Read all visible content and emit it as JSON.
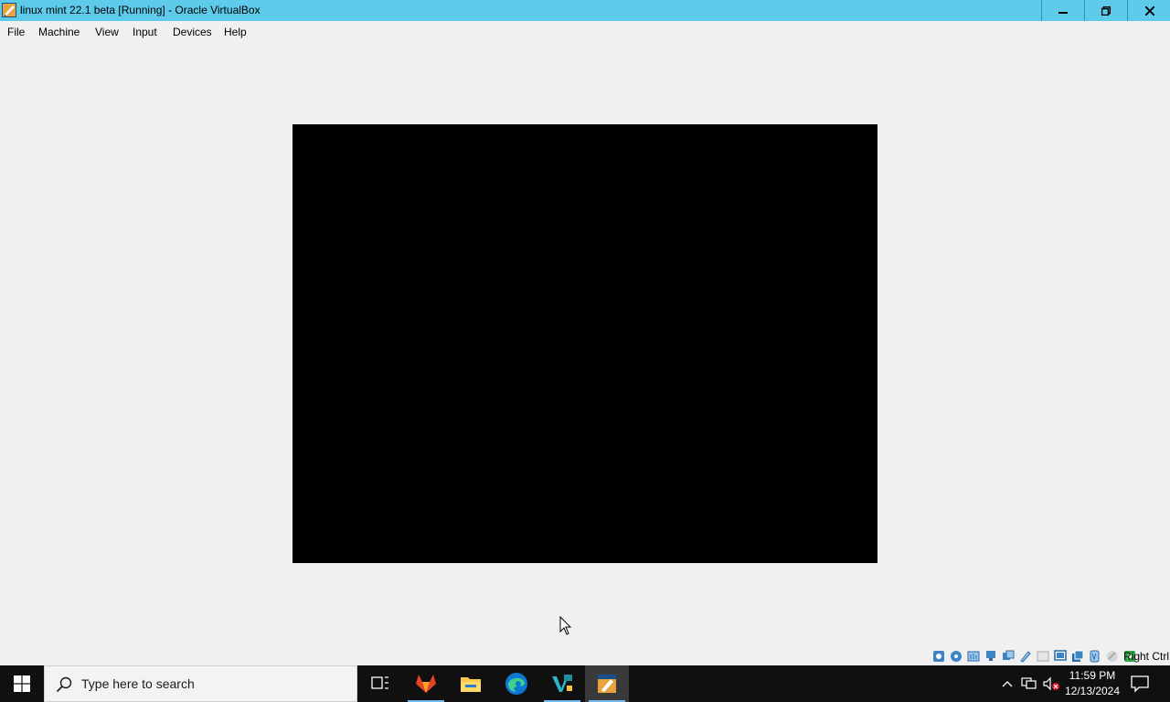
{
  "window": {
    "title": "linux mint 22.1 beta [Running] - Oracle VirtualBox",
    "controls": {
      "minimize": "minimize",
      "restore": "restore",
      "close": "close"
    }
  },
  "menu": {
    "file": "File",
    "machine": "Machine",
    "view": "View",
    "input": "Input",
    "devices": "Devices",
    "help": "Help"
  },
  "statusbar": {
    "icons": [
      "hard-disk-icon",
      "optical-drive-icon",
      "audio-icon",
      "network-icon",
      "usb-icon",
      "shared-folders-icon",
      "display-icon",
      "recording-icon",
      "cpu-icon",
      "mouse-integration-icon",
      "keyboard-icon"
    ],
    "host_key": "Right Ctrl"
  },
  "taskbar": {
    "search_placeholder": "Type here to search",
    "apps": [
      "task-view-icon",
      "gitlab-icon",
      "file-explorer-icon",
      "edge-icon",
      "visual-studio-icon",
      "virtualbox-icon"
    ],
    "accent": "#76b9ed",
    "clock": {
      "time": "11:59 PM",
      "date": "12/13/2024"
    }
  },
  "colors": {
    "titlebar": "#5ecbea",
    "taskbar": "#101010",
    "vm_screen": "#000000"
  }
}
